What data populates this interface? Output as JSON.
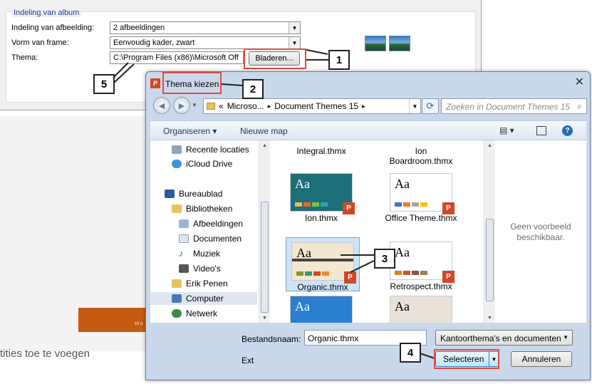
{
  "album": {
    "group_title": "Indeling van album",
    "rows": [
      {
        "label": "Indeling van afbeelding:",
        "value": "2 afbeeldingen"
      },
      {
        "label": "Vorm van frame:",
        "value": "Eenvoudig kader, zwart"
      },
      {
        "label": "Thema:",
        "value": "C:\\Program Files (x86)\\Microsoft Off"
      }
    ],
    "browse_label": "Bladeren..."
  },
  "background": {
    "bottom_text": "tities toe te voegen",
    "slide_label": "10 n"
  },
  "dialog": {
    "title": "Thema kiezen",
    "breadcrumb": [
      "«",
      "Microso...",
      "▸",
      "Document Themes 15",
      "▸"
    ],
    "search_placeholder": "Zoeken in Document Themes 15",
    "toolbar": {
      "organize": "Organiseren ▾",
      "new_folder": "Nieuwe map"
    },
    "nav_items": [
      {
        "label": "Recente locaties",
        "icon": "recent-places-icon"
      },
      {
        "label": "iCloud Drive",
        "icon": "icloud-icon"
      },
      {
        "label": "Bureaublad",
        "icon": "desktop-icon"
      },
      {
        "label": "Bibliotheken",
        "icon": "libraries-icon"
      },
      {
        "label": "Afbeeldingen",
        "icon": "pictures-icon"
      },
      {
        "label": "Documenten",
        "icon": "documents-icon"
      },
      {
        "label": "Muziek",
        "icon": "music-icon"
      },
      {
        "label": "Video's",
        "icon": "videos-icon"
      },
      {
        "label": "Erik Penen",
        "icon": "user-folder-icon"
      },
      {
        "label": "Computer",
        "icon": "computer-icon"
      },
      {
        "label": "Netwerk",
        "icon": "network-icon"
      }
    ],
    "files": [
      {
        "name": "Integral.thmx"
      },
      {
        "name": "Ion Boardroom.thmx"
      },
      {
        "name": "Ion.thmx"
      },
      {
        "name": "Office Theme.thmx"
      },
      {
        "name": "Organic.thmx"
      },
      {
        "name": "Retrospect.thmx"
      },
      {
        "name": ""
      },
      {
        "name": ""
      }
    ],
    "preview_text": "Geen voorbeeld beschikbaar.",
    "filename_label": "Bestandsnaam:",
    "filename_value": "Organic.thmx",
    "filetype_value": "Kantoorthema's en documenten",
    "ext_label": "Ext",
    "select_label": "Selecteren",
    "cancel_label": "Annuleren"
  },
  "callouts": [
    "1",
    "2",
    "3",
    "4",
    "5"
  ]
}
